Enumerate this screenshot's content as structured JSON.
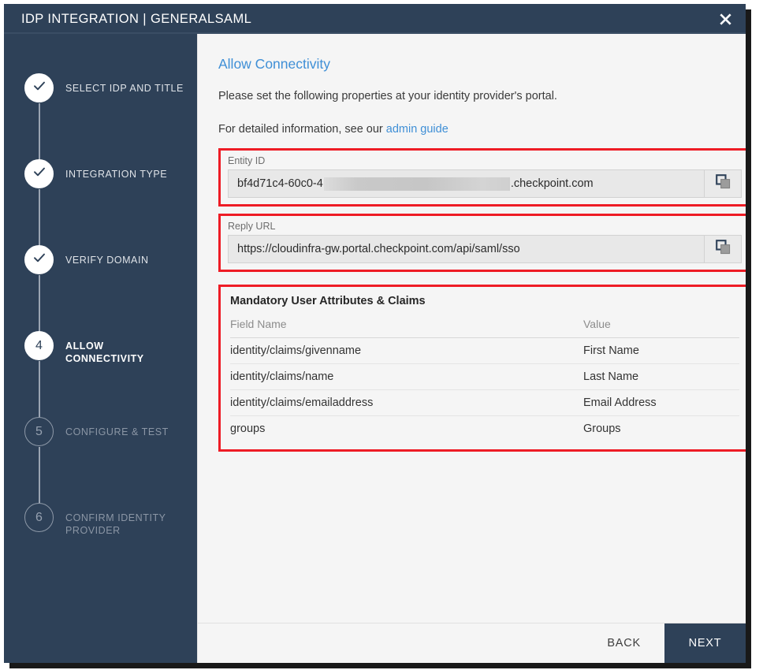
{
  "window": {
    "title": "IDP INTEGRATION | GENERALSAML",
    "close_icon": "close-icon"
  },
  "theme": {
    "navy": "#2e4158",
    "accent_blue": "#3f8fd6",
    "highlight_red": "#ee1c25",
    "panel_bg": "#f5f5f5"
  },
  "sidebar": {
    "steps": [
      {
        "number": "1",
        "label": "SELECT IDP AND TITLE",
        "state": "done",
        "icon": "check-icon"
      },
      {
        "number": "2",
        "label": "INTEGRATION TYPE",
        "state": "done",
        "icon": "check-icon"
      },
      {
        "number": "3",
        "label": "VERIFY DOMAIN",
        "state": "done",
        "icon": "check-icon"
      },
      {
        "number": "4",
        "label": "ALLOW CONNECTIVITY",
        "state": "active",
        "icon": ""
      },
      {
        "number": "5",
        "label": "CONFIGURE & TEST",
        "state": "todo",
        "icon": ""
      },
      {
        "number": "6",
        "label": "CONFIRM IDENTITY PROVIDER",
        "state": "todo",
        "icon": ""
      }
    ]
  },
  "main": {
    "heading": "Allow Connectivity",
    "intro": "Please set the following properties at your identity provider's portal.",
    "detail_prefix": "For detailed information, see our ",
    "detail_link": "admin guide",
    "entity_id": {
      "label": "Entity ID",
      "value_prefix": "bf4d71c4-60c0-4",
      "value_redacted": true,
      "value_suffix": ".checkpoint.com",
      "copy_icon": "copy-icon"
    },
    "reply_url": {
      "label": "Reply URL",
      "value": "https://cloudinfra-gw.portal.checkpoint.com/api/saml/sso",
      "copy_icon": "copy-icon"
    },
    "claims": {
      "title": "Mandatory User Attributes & Claims",
      "headers": [
        "Field Name",
        "Value"
      ],
      "rows": [
        {
          "field": "identity/claims/givenname",
          "value": "First Name"
        },
        {
          "field": "identity/claims/name",
          "value": "Last Name"
        },
        {
          "field": "identity/claims/emailaddress",
          "value": "Email Address"
        },
        {
          "field": "groups",
          "value": "Groups"
        }
      ]
    }
  },
  "footer": {
    "back_label": "BACK",
    "next_label": "NEXT"
  }
}
